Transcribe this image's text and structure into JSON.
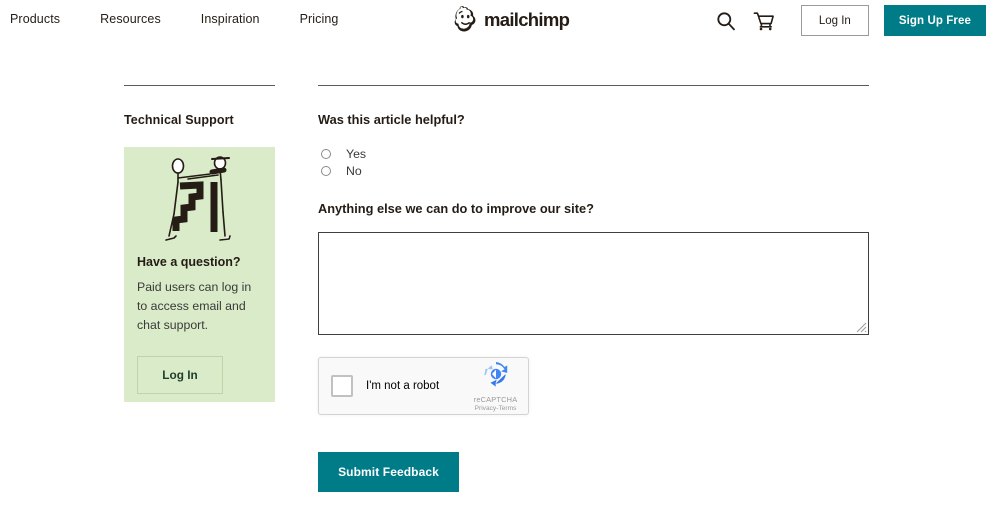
{
  "header": {
    "nav_items": [
      {
        "label": "Products"
      },
      {
        "label": "Resources"
      },
      {
        "label": "Inspiration"
      },
      {
        "label": "Pricing"
      }
    ],
    "brand": "mailchimp",
    "search_icon": "search-icon",
    "cart_icon": "shopping-cart-icon",
    "login_label": "Log In",
    "signup_label": "Sign Up Free",
    "accent_color": "#007c89"
  },
  "sidebar": {
    "heading": "Technical Support",
    "card": {
      "illustration": "two-people-with-zigzag-illustration",
      "title": "Have a question?",
      "body": "Paid users can log in to access email and chat support.",
      "login_label": "Log In",
      "background_color": "#d9ebc8"
    }
  },
  "main": {
    "helpful_question": "Was this article helpful?",
    "radio_options": [
      {
        "label": "Yes",
        "value": "yes",
        "selected": false
      },
      {
        "label": "No",
        "value": "no",
        "selected": false
      }
    ],
    "improve_question": "Anything else we can do to improve our site?",
    "feedback_value": "",
    "feedback_placeholder": "",
    "recaptcha": {
      "checkbox_label": "I'm not a robot",
      "brand": "reCAPTCHA",
      "privacy_label": "Privacy",
      "separator": "-",
      "terms_label": "Terms",
      "logo_color": "#4285f4"
    },
    "submit_label": "Submit Feedback"
  }
}
